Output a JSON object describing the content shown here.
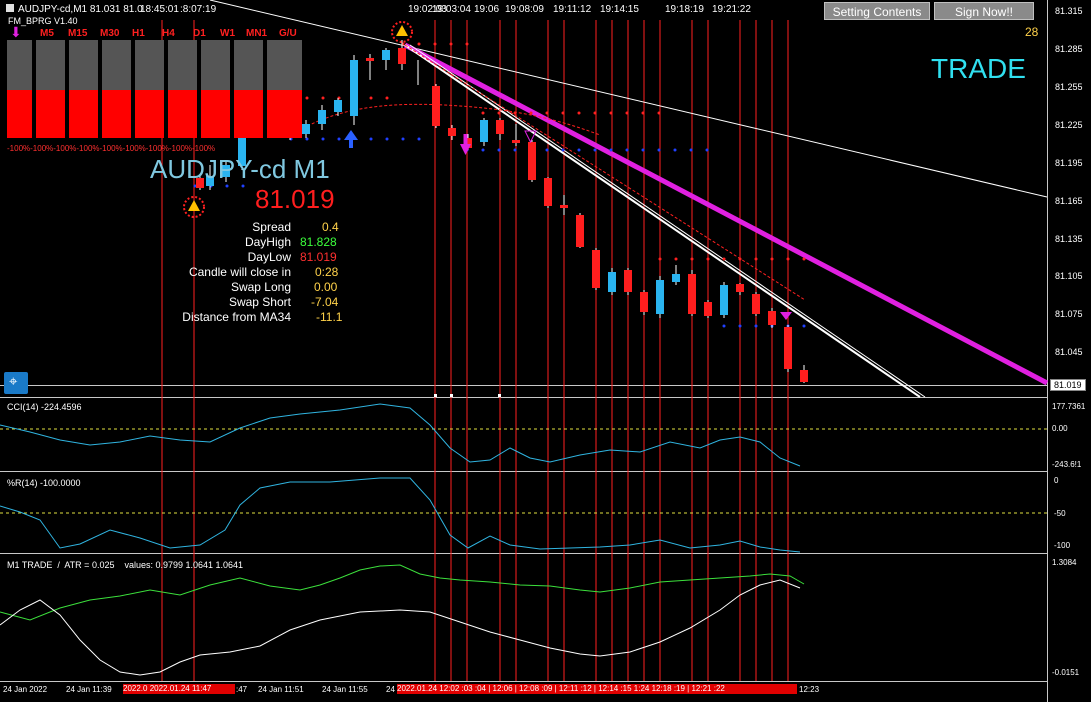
{
  "header": {
    "symbol_line": "AUDJPY-cd,M1  81.031 81.0",
    "indicator_name": "FM_BPRG V1.40",
    "top_times": [
      "18:45:01",
      ":8:07:19",
      "19:02:03",
      "19:03:04",
      "19:06",
      "19:08:09",
      "19:11:12",
      "19:14:15",
      "19:18:19",
      "19:21:22"
    ]
  },
  "buttons": {
    "setting": "Setting Contents",
    "signnow": "Sign Now!!"
  },
  "counter": "28",
  "trade_label": "TRADE",
  "timeframes": [
    "M5",
    "M15",
    "M30",
    "H1",
    "H4",
    "D1",
    "W1",
    "MN1",
    "G/U"
  ],
  "tf_strength": "-100%-100%-100%-100%-100%-100%-100%-100%-100%",
  "symbol_display": "AUDJPY-cd M1",
  "price_display": "81.019",
  "info": [
    {
      "label": "Spread",
      "value": "0.4",
      "color": "#ffd24a"
    },
    {
      "label": "DayHigh",
      "value": "81.828",
      "color": "#3cff3c"
    },
    {
      "label": "DayLow",
      "value": "81.019",
      "color": "#ff3030"
    },
    {
      "label": "Candle will close in",
      "value": "0:28",
      "color": "#ffd24a"
    },
    {
      "label": "Swap Long",
      "value": "0.00",
      "color": "#ffd24a"
    },
    {
      "label": "Swap Short",
      "value": "-7.04",
      "color": "#ffd24a"
    },
    {
      "label": "Distance from MA34",
      "value": "-11.1",
      "color": "#ffd24a"
    }
  ],
  "price_axis": [
    "81.315",
    "81.285",
    "81.255",
    "81.225",
    "81.195",
    "81.165",
    "81.135",
    "81.105",
    "81.075",
    "81.045",
    "81.019"
  ],
  "cci": {
    "title": "CCI(14) -224.4596",
    "axis": [
      "177.7361",
      "0.00",
      "-243.6!1"
    ]
  },
  "wpr": {
    "title": "%R(14) -100.0000",
    "axis": [
      "0",
      "-50",
      "-100"
    ]
  },
  "m1trade": {
    "title": "M1 TRADE  /  ATR = 0.025    values: 0.9799 1.0641 1.0641",
    "axis": [
      "1.3084",
      "-0.0151"
    ]
  },
  "time_axis": [
    "24 Jan 2022",
    "24 Jan 11:39",
    "24 Jan 11:51",
    "24 Jan 11:55",
    "24",
    "12:23"
  ],
  "time_red": [
    "2022.0 2022.01.24 11:47",
    "2022.01.24 12:02 :03 :04 | 12:06 | 12:08 :09 | 12:11 :12 | 12:14 :15 1:24 12:18 :19 | 12:21 :22"
  ],
  "time_extra": ":47",
  "colors": {
    "bull": "#2ab4f0",
    "bear": "#ff1e1e",
    "trend": "#e020e0",
    "bg": "#000000"
  }
}
